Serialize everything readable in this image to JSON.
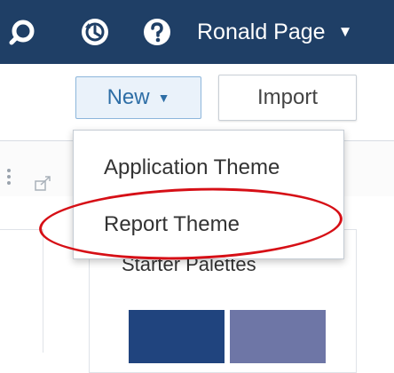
{
  "topbar": {
    "icons": [
      "search-icon",
      "recent-history-icon",
      "help-icon"
    ],
    "user_name": "Ronald Page",
    "user_caret": "▼"
  },
  "toolbar": {
    "new_label": "New",
    "new_caret": "▼",
    "import_label": "Import"
  },
  "new_menu": {
    "items": [
      "Application Theme",
      "Report Theme"
    ],
    "highlighted_item": "Report Theme"
  },
  "card": {
    "title": "Starter Palettes"
  },
  "colors": {
    "topbar": "#1f3f66",
    "new_button_text": "#2e6ea6",
    "annotation": "#d60f16",
    "swatch_dark": "#20447e",
    "swatch_light": "#6e76a6"
  }
}
